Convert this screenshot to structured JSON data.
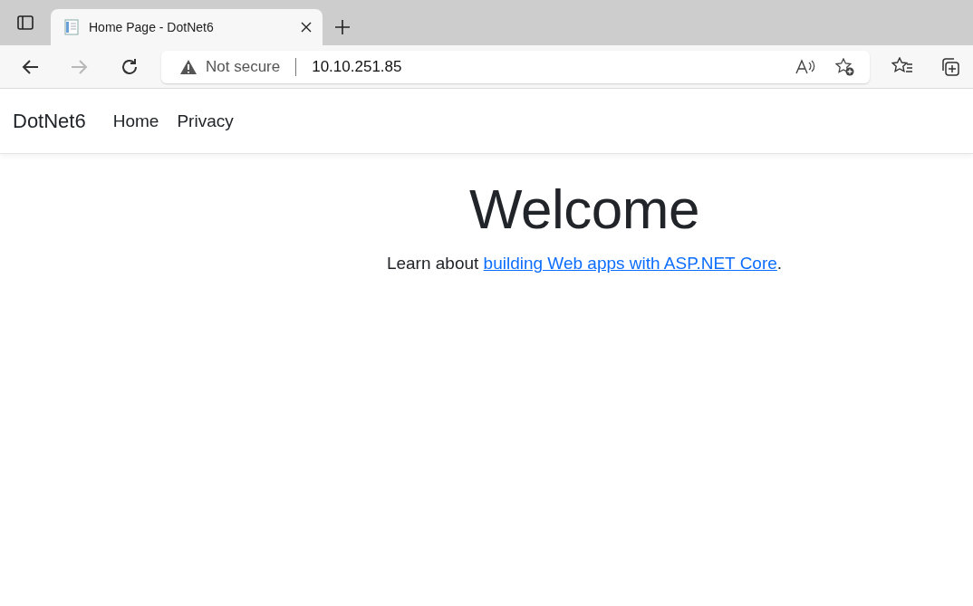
{
  "browser": {
    "tabs": [
      {
        "title": "Home Page - DotNet6",
        "selected": true
      }
    ],
    "nav_buttons": [
      {
        "kind": "back",
        "disabled": false
      },
      {
        "kind": "forward",
        "disabled": true
      },
      {
        "kind": "reload",
        "disabled": false
      }
    ],
    "address_bar": {
      "security": "Not secure",
      "url": "10.10.251.85"
    }
  },
  "navbar": {
    "brand": "DotNet6",
    "links": [
      {
        "label": "Home"
      },
      {
        "label": "Privacy"
      }
    ]
  },
  "main": {
    "heading": "Welcome",
    "text_before": "Learn about ",
    "link": "building Web apps with ASP.NET Core",
    "text_after": "."
  }
}
